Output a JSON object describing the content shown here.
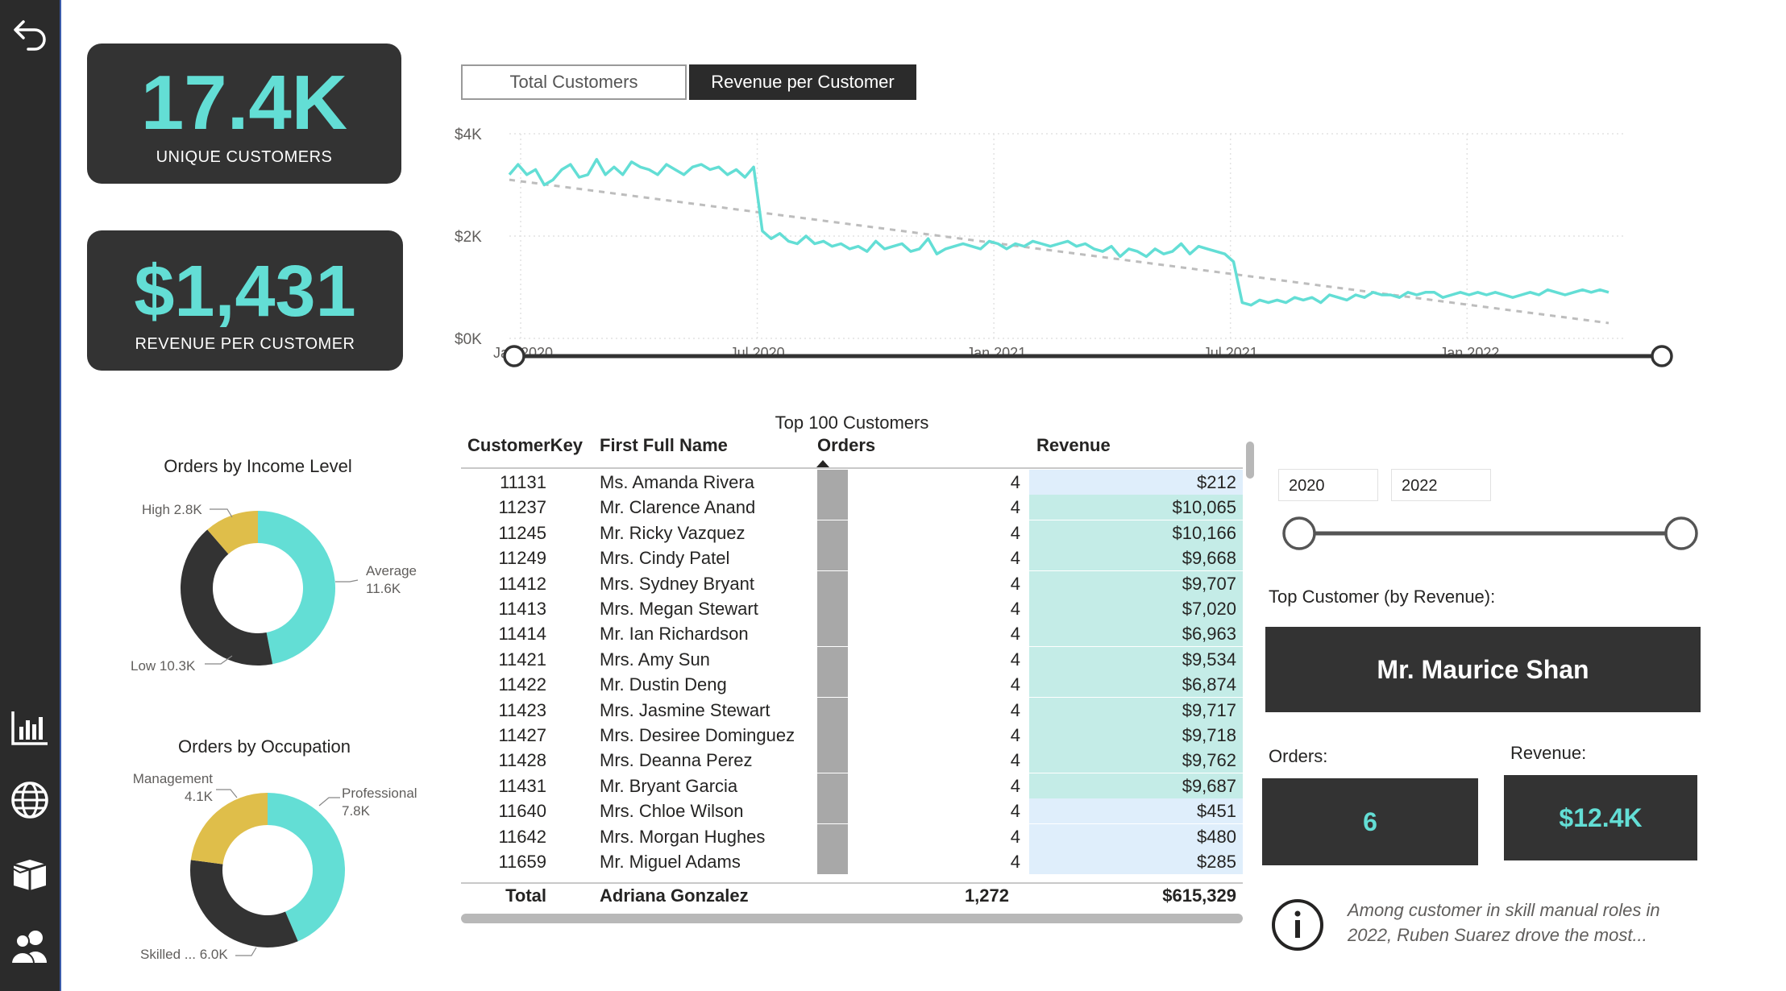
{
  "nav": {
    "items": [
      {
        "name": "back-arrow-icon"
      },
      {
        "name": "bar-chart-icon"
      },
      {
        "name": "globe-icon"
      },
      {
        "name": "box-icon"
      },
      {
        "name": "users-icon"
      }
    ]
  },
  "kpis": {
    "customers": {
      "value": "17.4K",
      "label": "UNIQUE CUSTOMERS"
    },
    "revenue": {
      "value": "$1,431",
      "label": "REVENUE PER CUSTOMER"
    }
  },
  "tabs": [
    {
      "label": "Total Customers",
      "active": false
    },
    {
      "label": "Revenue per Customer",
      "active": true
    }
  ],
  "colors": {
    "accent": "#63ded5",
    "dark": "#333333",
    "gold": "#dfbe4a",
    "trend": "#bdbdbd"
  },
  "chart_data": [
    {
      "type": "line",
      "title": "",
      "y_ticks": [
        "$4K",
        "$2K",
        "$0K"
      ],
      "ylim": [
        0,
        4000
      ],
      "x_ticks": [
        "Jan 2020",
        "Jul 2020",
        "Jan 2021",
        "Jul 2021",
        "Jan 2022"
      ],
      "grid": true,
      "trendline": {
        "start": 3100,
        "end": 300
      },
      "series": [
        {
          "values": [
            3200,
            3400,
            3200,
            3300,
            3000,
            3100,
            3300,
            3400,
            3150,
            3200,
            3500,
            3200,
            3350,
            3200,
            3450,
            3350,
            3300,
            3200,
            3400,
            3300,
            3200,
            3350,
            3400,
            3300,
            3350,
            3200,
            3300,
            3150,
            3350,
            2100,
            1950,
            2050,
            1900,
            1850,
            2000,
            1850,
            1900,
            1800,
            1850,
            1750,
            1800,
            1700,
            1900,
            1750,
            1800,
            1850,
            1700,
            1750,
            1950,
            1650,
            1750,
            1800,
            1850,
            1800,
            1750,
            1900,
            1850,
            1750,
            1850,
            1800,
            1900,
            1850,
            1800,
            1850,
            1900,
            1800,
            1850,
            1750,
            1700,
            1800,
            1600,
            1750,
            1700,
            1600,
            1750,
            1650,
            1700,
            1850,
            1650,
            1800,
            1750,
            1700,
            1650,
            1500,
            700,
            650,
            750,
            700,
            750,
            700,
            800,
            750,
            800,
            700,
            850,
            800,
            750,
            850,
            800,
            900,
            850,
            850,
            800,
            900,
            850,
            900,
            900,
            800,
            850,
            900,
            850,
            900,
            850,
            900,
            850,
            800,
            850,
            900,
            850,
            950,
            900,
            850,
            900,
            950,
            900,
            950,
            900
          ]
        }
      ],
      "range_slider": "full"
    },
    {
      "type": "pie",
      "title": "Orders by Income Level",
      "labels": [
        "Average",
        "Low",
        "High"
      ],
      "values": [
        11.6,
        10.3,
        2.8
      ],
      "label_text": [
        "Average\n11.6K",
        "Low 10.3K",
        "High 2.8K"
      ],
      "colors": [
        "#63ded5",
        "#333333",
        "#dfbe4a"
      ]
    },
    {
      "type": "pie",
      "title": "Orders by Occupation",
      "labels": [
        "Professional",
        "Skilled ...",
        "Management"
      ],
      "values": [
        7.8,
        6.0,
        4.1
      ],
      "label_text": [
        "Professional\n7.8K",
        "Skilled ... 6.0K",
        "Management\n4.1K"
      ],
      "colors": [
        "#63ded5",
        "#333333",
        "#dfbe4a"
      ]
    }
  ],
  "table": {
    "title": "Top 100 Customers",
    "headers": [
      "CustomerKey",
      "First Full Name",
      "Orders",
      "Revenue"
    ],
    "rows": [
      [
        "11131",
        "Ms. Amanda Rivera",
        "4",
        "$212"
      ],
      [
        "11237",
        "Mr. Clarence Anand",
        "4",
        "$10,065"
      ],
      [
        "11245",
        "Mr. Ricky Vazquez",
        "4",
        "$10,166"
      ],
      [
        "11249",
        "Mrs. Cindy Patel",
        "4",
        "$9,668"
      ],
      [
        "11412",
        "Mrs. Sydney Bryant",
        "4",
        "$9,707"
      ],
      [
        "11413",
        "Mrs. Megan Stewart",
        "4",
        "$7,020"
      ],
      [
        "11414",
        "Mr. Ian Richardson",
        "4",
        "$6,963"
      ],
      [
        "11421",
        "Mrs. Amy Sun",
        "4",
        "$9,534"
      ],
      [
        "11422",
        "Mr. Dustin Deng",
        "4",
        "$6,874"
      ],
      [
        "11423",
        "Mrs. Jasmine Stewart",
        "4",
        "$9,717"
      ],
      [
        "11427",
        "Mrs. Desiree Dominguez",
        "4",
        "$9,718"
      ],
      [
        "11428",
        "Mrs. Deanna Perez",
        "4",
        "$9,762"
      ],
      [
        "11431",
        "Mr. Bryant Garcia",
        "4",
        "$9,687"
      ],
      [
        "11640",
        "Mrs. Chloe Wilson",
        "4",
        "$451"
      ],
      [
        "11642",
        "Mrs. Morgan Hughes",
        "4",
        "$480"
      ],
      [
        "11659",
        "Mr. Miguel Adams",
        "4",
        "$285"
      ]
    ],
    "total": {
      "label": "Total",
      "name": "Adriana Gonzalez",
      "orders": "1,272",
      "revenue": "$615,329"
    }
  },
  "year_filter": {
    "from": "2020",
    "to": "2022"
  },
  "top_customer": {
    "label": "Top Customer (by Revenue):",
    "name": "Mr. Maurice Shan",
    "orders_label": "Orders:",
    "orders": "6",
    "revenue_label": "Revenue:",
    "revenue": "$12.4K"
  },
  "insight": {
    "text": "Among customer in skill manual roles in 2022, Ruben Suarez drove the most..."
  }
}
